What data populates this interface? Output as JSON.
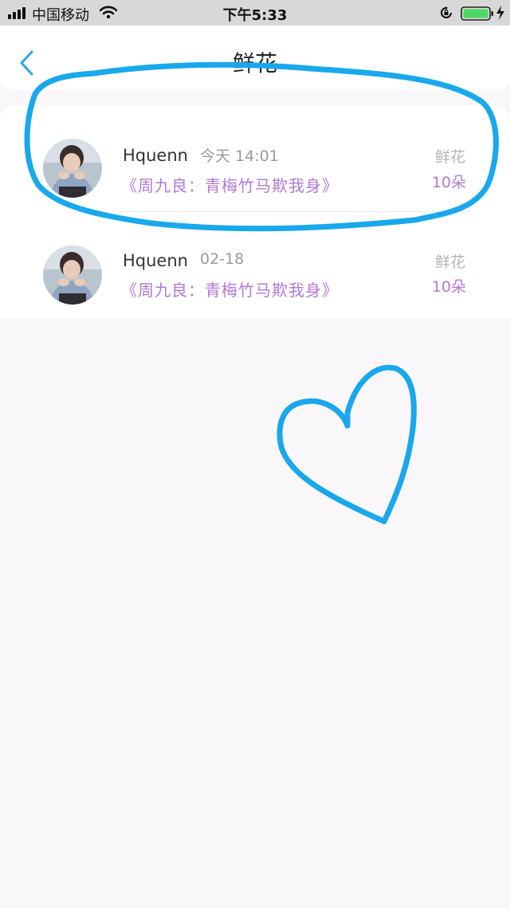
{
  "status_bar": {
    "carrier": "中国移动",
    "time": "下午5:33"
  },
  "nav": {
    "title": "鲜花"
  },
  "records": [
    {
      "name": "Hquenn",
      "date": "今天 14:01",
      "book": "《周九良：青梅竹马欺我身》",
      "kind": "鲜花",
      "count": "10朵"
    },
    {
      "name": "Hquenn",
      "date": "02-18",
      "book": "《周九良：青梅竹马欺我身》",
      "kind": "鲜花",
      "count": "10朵"
    }
  ],
  "colors": {
    "accent": "#2ba9e8",
    "book_purple": "#b07ad6",
    "annotation_blue": "#19a8ec",
    "battery_green": "#4cd964"
  }
}
